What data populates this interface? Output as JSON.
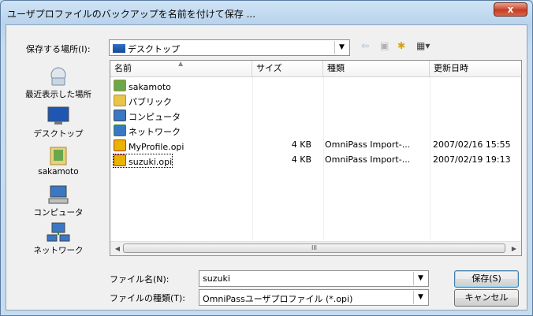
{
  "window": {
    "title": "ユーザプロファイルのバックアップを名前を付けて保存 ...",
    "close_label": "x"
  },
  "location": {
    "label": "保存する場所(I):",
    "selected": "デスクトップ"
  },
  "places": [
    {
      "label": "最近表示した場所",
      "icon": "recent-places-icon"
    },
    {
      "label": "デスクトップ",
      "icon": "desktop-icon"
    },
    {
      "label": "sakamoto",
      "icon": "user-folder-icon"
    },
    {
      "label": "コンピュータ",
      "icon": "computer-icon"
    },
    {
      "label": "ネットワーク",
      "icon": "network-icon"
    }
  ],
  "columns": {
    "name": "名前",
    "size": "サイズ",
    "type": "種類",
    "date": "更新日時"
  },
  "files": [
    {
      "name": "sakamoto",
      "size": "",
      "type": "",
      "date": "",
      "icon": "user-folder-icon"
    },
    {
      "name": "パブリック",
      "size": "",
      "type": "",
      "date": "",
      "icon": "folder-icon"
    },
    {
      "name": "コンピュータ",
      "size": "",
      "type": "",
      "date": "",
      "icon": "computer-icon"
    },
    {
      "name": "ネットワーク",
      "size": "",
      "type": "",
      "date": "",
      "icon": "network-icon"
    },
    {
      "name": "MyProfile.opi",
      "size": "4 KB",
      "type": "OmniPass Import-...",
      "date": "2007/02/16 15:55",
      "icon": "omnipass-file-icon"
    },
    {
      "name": "suzuki.opi",
      "size": "4 KB",
      "type": "OmniPass Import-...",
      "date": "2007/02/19 19:13",
      "icon": "omnipass-file-icon"
    }
  ],
  "scrollbar": {
    "thumb_grip": "III"
  },
  "filename": {
    "label": "ファイル名(N):",
    "value": "suzuki"
  },
  "filetype": {
    "label": "ファイルの種類(T):",
    "value": "OmniPassユーザプロファイル (*.opi)"
  },
  "buttons": {
    "save": "保存(S)",
    "cancel": "キャンセル"
  },
  "colors": {
    "title_gradient": "#b9d3ec",
    "close_button": "#c13a22",
    "focus_accent": "#3c7fb1"
  }
}
